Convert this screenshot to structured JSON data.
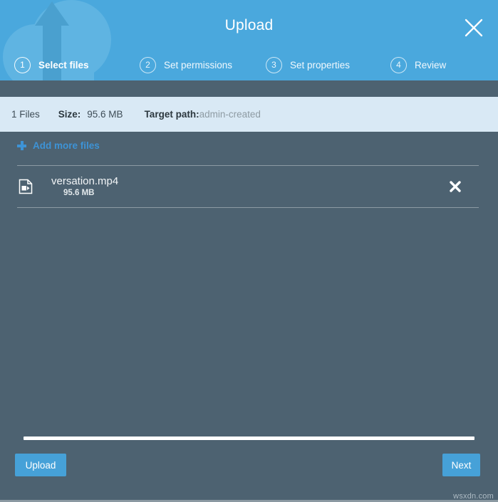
{
  "header": {
    "title": "Upload",
    "close_icon": "close-icon",
    "watermark_icon": "cloud-upload-icon",
    "accent_color": "#4aa8dd",
    "steps": [
      {
        "number": "1",
        "label": "Select files",
        "active": true
      },
      {
        "number": "2",
        "label": "Set permissions",
        "active": false
      },
      {
        "number": "3",
        "label": "Set properties",
        "active": false
      },
      {
        "number": "4",
        "label": "Review",
        "active": false
      }
    ]
  },
  "info_bar": {
    "files_count": "1 Files",
    "size_label": "Size:",
    "size_value": "95.6 MB",
    "target_path_label": "Target path:",
    "target_path_value": "admin-created",
    "background_color": "#d9e9f5"
  },
  "panel": {
    "add_more_label": "Add more files",
    "add_more_icon": "plus-icon",
    "background_color": "#4d6271",
    "files": [
      {
        "icon": "video-file-icon",
        "name": "versation.mp4",
        "size": "95.6 MB",
        "remove_icon": "close-icon"
      }
    ]
  },
  "footer": {
    "upload_label": "Upload",
    "next_label": "Next",
    "button_color": "#46a1d8",
    "progress_percent": 0
  },
  "watermark": {
    "text": "wsxdn.com"
  }
}
